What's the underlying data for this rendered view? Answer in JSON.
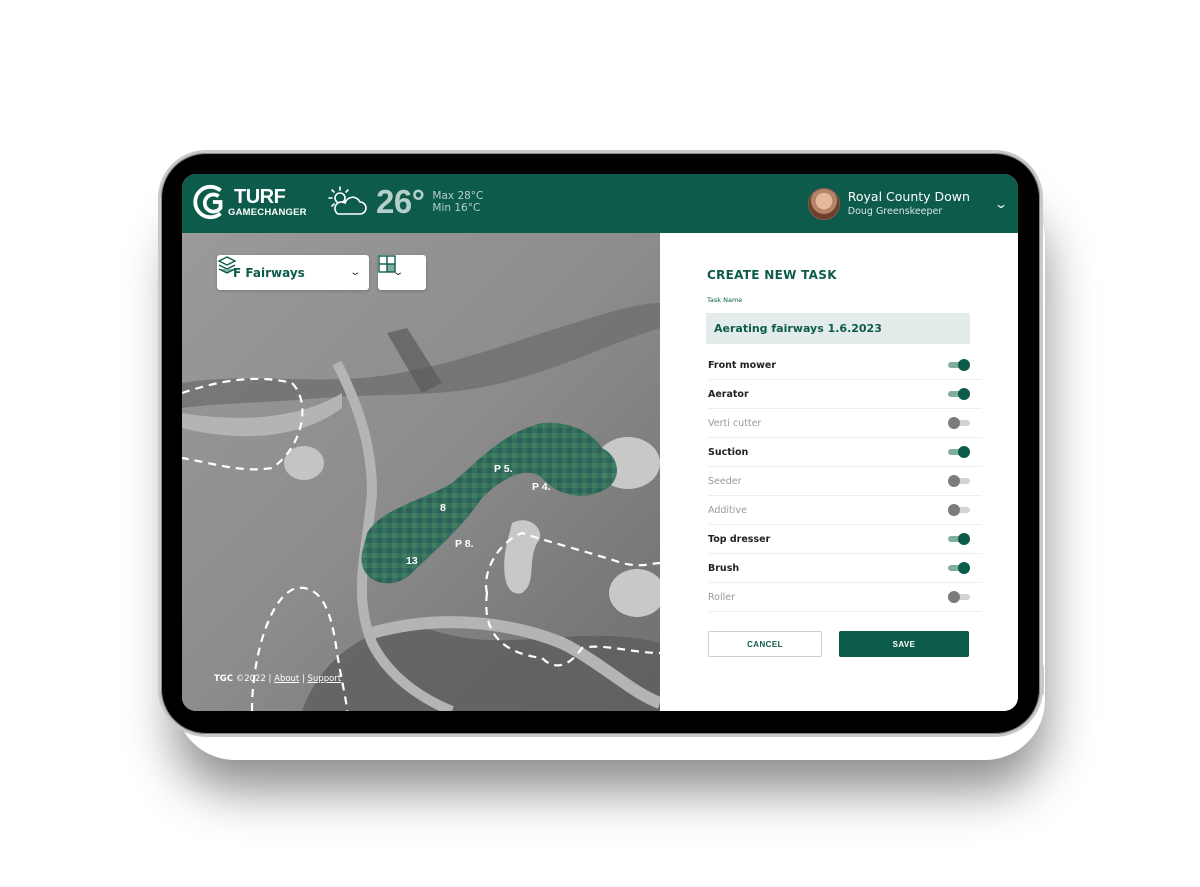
{
  "app": {
    "logo_main": "TURF",
    "logo_sub": "GAMECHANGER"
  },
  "weather": {
    "icon": "partly-cloudy-icon",
    "temperature": "26°",
    "max": "Max 28°C",
    "min": "Min 16°C"
  },
  "user": {
    "club": "Royal County Down",
    "name": "Doug Greenskeeper"
  },
  "map": {
    "layer_select": {
      "icon": "layers-icon",
      "value": "F  Fairways"
    },
    "view_select": {
      "icon": "grid-view-icon"
    },
    "zone_labels": [
      "P 5.",
      "P 4.",
      "8",
      "P 8.",
      "13"
    ],
    "footer": {
      "brand": "TGC",
      "copyright": "©2022 |",
      "about": "About",
      "separator": "|",
      "support": "Support"
    }
  },
  "task_form": {
    "title": "CREATE NEW TASK",
    "name_label": "Task Name",
    "name_value": "Aerating fairways 1.6.2023",
    "options": [
      {
        "label": "Front mower",
        "enabled": true
      },
      {
        "label": "Aerator",
        "enabled": true
      },
      {
        "label": "Verti cutter",
        "enabled": false
      },
      {
        "label": "Suction",
        "enabled": true
      },
      {
        "label": "Seeder",
        "enabled": false
      },
      {
        "label": "Additive",
        "enabled": false
      },
      {
        "label": "Top dresser",
        "enabled": true
      },
      {
        "label": "Brush",
        "enabled": true
      },
      {
        "label": "Roller",
        "enabled": false
      }
    ],
    "cancel_label": "CANCEL",
    "save_label": "SAVE"
  },
  "colors": {
    "brand": "#0d5c4b",
    "toggle_on_track": "#7faf9f",
    "toggle_off_knob": "#7b7b7b",
    "input_bg": "#e3ecea"
  }
}
